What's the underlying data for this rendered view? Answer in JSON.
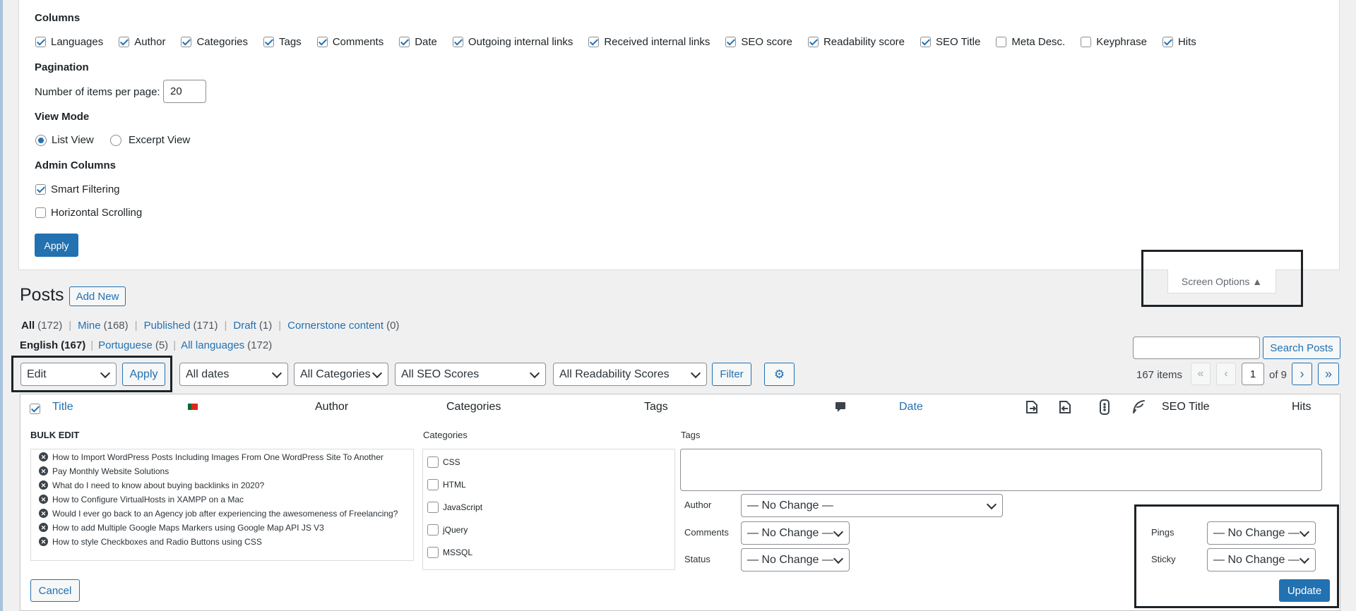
{
  "screen_options": {
    "columns_title": "Columns",
    "columns": [
      {
        "label": "Languages",
        "checked": true
      },
      {
        "label": "Author",
        "checked": true
      },
      {
        "label": "Categories",
        "checked": true
      },
      {
        "label": "Tags",
        "checked": true
      },
      {
        "label": "Comments",
        "checked": true
      },
      {
        "label": "Date",
        "checked": true
      },
      {
        "label": "Outgoing internal links",
        "checked": true
      },
      {
        "label": "Received internal links",
        "checked": true
      },
      {
        "label": "SEO score",
        "checked": true
      },
      {
        "label": "Readability score",
        "checked": true
      },
      {
        "label": "SEO Title",
        "checked": true
      },
      {
        "label": "Meta Desc.",
        "checked": false
      },
      {
        "label": "Keyphrase",
        "checked": false
      },
      {
        "label": "Hits",
        "checked": true
      }
    ],
    "pagination_title": "Pagination",
    "items_per_page_label": "Number of items per page:",
    "items_per_page_value": "20",
    "view_mode_title": "View Mode",
    "view_modes": [
      {
        "label": "List View",
        "checked": true
      },
      {
        "label": "Excerpt View",
        "checked": false
      }
    ],
    "admin_columns_title": "Admin Columns",
    "admin_options": [
      {
        "label": "Smart Filtering",
        "checked": true
      },
      {
        "label": "Horizontal Scrolling",
        "checked": false
      }
    ],
    "apply_label": "Apply",
    "toggle_label": "Screen Options ▲"
  },
  "posts": {
    "title": "Posts",
    "add_new_label": "Add New",
    "status_links": [
      {
        "label": "All",
        "count": "(172)",
        "current": true
      },
      {
        "label": "Mine",
        "count": "(168)",
        "current": false
      },
      {
        "label": "Published",
        "count": "(171)",
        "current": false
      },
      {
        "label": "Draft",
        "count": "(1)",
        "current": false
      },
      {
        "label": "Cornerstone content",
        "count": "(0)",
        "current": false
      }
    ],
    "language_links": [
      {
        "label": "English",
        "count": "(167)",
        "current": true
      },
      {
        "label": "Portuguese",
        "count": "(5)",
        "current": false
      },
      {
        "label": "All languages",
        "count": "(172)",
        "current": false
      }
    ],
    "search_placeholder": "",
    "search_button": "Search Posts",
    "bulk_action_value": "Edit",
    "bulk_apply_label": "Apply",
    "filters": {
      "dates": "All dates",
      "categories": "All Categories",
      "seo_scores": "All SEO Scores",
      "readability": "All Readability Scores",
      "filter_button": "Filter"
    },
    "pagination": {
      "items_count": "167 items",
      "first": "«",
      "prev": "‹",
      "current_page": "1",
      "of_total": "of 9",
      "next": "›",
      "last": "»"
    },
    "table_headers": {
      "title": "Title",
      "author": "Author",
      "categories": "Categories",
      "tags": "Tags",
      "date": "Date",
      "seo_title": "SEO Title",
      "hits": "Hits"
    }
  },
  "bulk_edit": {
    "heading": "BULK EDIT",
    "posts": [
      "How to Import WordPress Posts Including Images From One WordPress Site To Another",
      "Pay Monthly Website Solutions",
      "What do I need to know about buying backlinks in 2020?",
      "How to Configure VirtualHosts in XAMPP on a Mac",
      "Would I ever go back to an Agency job after experiencing the awesomeness of Freelancing?",
      "How to add Multiple Google Maps Markers using Google Map API JS V3",
      "How to style Checkboxes and Radio Buttons using CSS"
    ],
    "categories_label": "Categories",
    "categories": [
      "CSS",
      "HTML",
      "JavaScript",
      "jQuery",
      "MSSQL"
    ],
    "tags_label": "Tags",
    "author_label": "Author",
    "author_value": "— No Change —",
    "comments_label": "Comments",
    "comments_value": "— No Change —",
    "status_label": "Status",
    "status_value": "— No Change —",
    "pings_label": "Pings",
    "pings_value": "— No Change —",
    "sticky_label": "Sticky",
    "sticky_value": "— No Change —",
    "cancel_label": "Cancel",
    "update_label": "Update"
  },
  "colors": {
    "accent": "#2271b1",
    "background": "#f0f0f1",
    "highlight_border": "#1d2327"
  }
}
